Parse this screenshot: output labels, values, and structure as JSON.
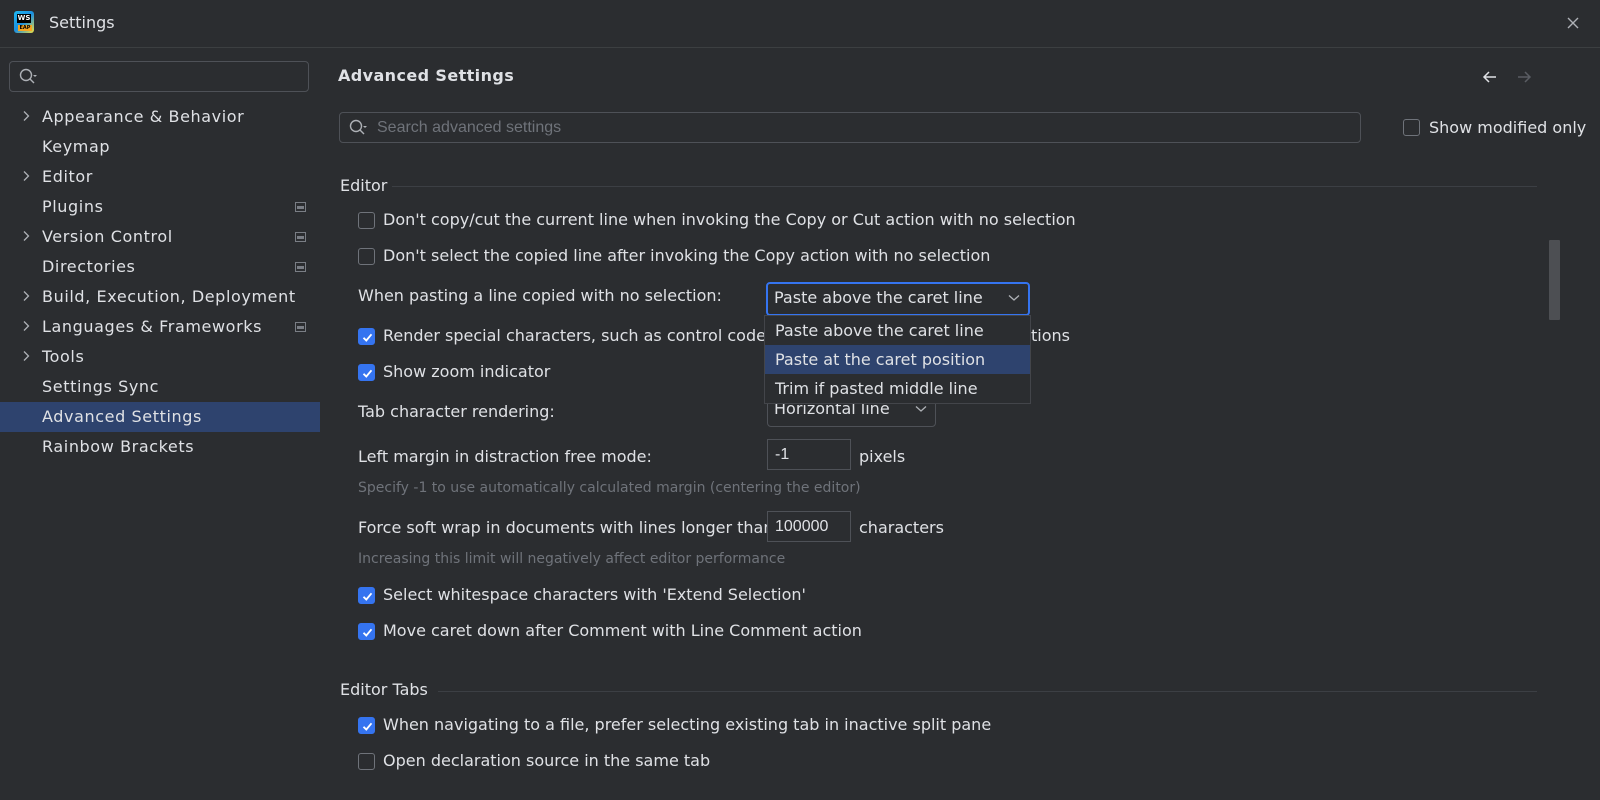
{
  "window": {
    "title": "Settings",
    "app_icon": {
      "name": "webstorm-eap-icon",
      "text_top": "WS",
      "text_bottom": "EAP"
    },
    "close_icon": "close-icon"
  },
  "sidebar": {
    "search": {
      "value": "",
      "placeholder": ""
    },
    "items": [
      {
        "label": "Appearance & Behavior",
        "expandable": true,
        "project_icon": false,
        "selected": false
      },
      {
        "label": "Keymap",
        "expandable": false,
        "project_icon": false,
        "selected": false
      },
      {
        "label": "Editor",
        "expandable": true,
        "project_icon": false,
        "selected": false
      },
      {
        "label": "Plugins",
        "expandable": false,
        "project_icon": true,
        "selected": false
      },
      {
        "label": "Version Control",
        "expandable": true,
        "project_icon": true,
        "selected": false
      },
      {
        "label": "Directories",
        "expandable": false,
        "project_icon": true,
        "selected": false
      },
      {
        "label": "Build, Execution, Deployment",
        "expandable": true,
        "project_icon": false,
        "selected": false
      },
      {
        "label": "Languages & Frameworks",
        "expandable": true,
        "project_icon": true,
        "selected": false
      },
      {
        "label": "Tools",
        "expandable": true,
        "project_icon": false,
        "selected": false
      },
      {
        "label": "Settings Sync",
        "expandable": false,
        "project_icon": false,
        "selected": false
      },
      {
        "label": "Advanced Settings",
        "expandable": false,
        "project_icon": false,
        "selected": true
      },
      {
        "label": "Rainbow Brackets",
        "expandable": false,
        "project_icon": false,
        "selected": false
      }
    ]
  },
  "main": {
    "title": "Advanced Settings",
    "search": {
      "value": "",
      "placeholder": "Search advanced settings"
    },
    "show_modified_only": {
      "label": "Show modified only",
      "checked": false
    },
    "sections": {
      "editor": {
        "title": "Editor",
        "dont_copy_cut": {
          "label": "Don't copy/cut the current line when invoking the Copy or Cut action with no selection",
          "checked": false
        },
        "dont_select_copied": {
          "label": "Don't select the copied line after invoking the Copy action with no selection",
          "checked": false
        },
        "paste_mode": {
          "label": "When pasting a line copied with no selection:",
          "value": "Paste above the caret line",
          "options": [
            "Paste above the caret line",
            "Paste at the caret position",
            "Trim if pasted middle line"
          ],
          "highlighted_option": "Paste at the caret position"
        },
        "render_special": {
          "label_left": "Render special characters, such as control codes,",
          "label_right": "tions",
          "checked": true
        },
        "show_zoom": {
          "label": "Show zoom indicator",
          "checked": true
        },
        "tab_rendering": {
          "label": "Tab character rendering:",
          "value": "Horizontal line"
        },
        "left_margin": {
          "label": "Left margin in distraction free mode:",
          "value": "-1",
          "unit": "pixels",
          "hint": "Specify -1 to use automatically calculated margin (centering the editor)"
        },
        "soft_wrap": {
          "label": "Force soft wrap in documents with lines longer than:",
          "value": "100000",
          "unit": "characters",
          "hint": "Increasing this limit will negatively affect editor performance"
        },
        "select_whitespace": {
          "label": "Select whitespace characters with 'Extend Selection'",
          "checked": true
        },
        "move_caret": {
          "label": "Move caret down after Comment with Line Comment action",
          "checked": true
        }
      },
      "editor_tabs": {
        "title": "Editor Tabs",
        "prefer_existing_tab": {
          "label": "When navigating to a file, prefer selecting existing tab in inactive split pane",
          "checked": true
        },
        "open_declaration": {
          "label": "Open declaration source in the same tab",
          "checked": false
        }
      }
    }
  },
  "colors": {
    "background": "#2b2d30",
    "accent": "#3574f0",
    "selection": "#2e436e",
    "text": "#dfe1e5",
    "hint_text": "#6f737a",
    "border": "#4e5157"
  }
}
